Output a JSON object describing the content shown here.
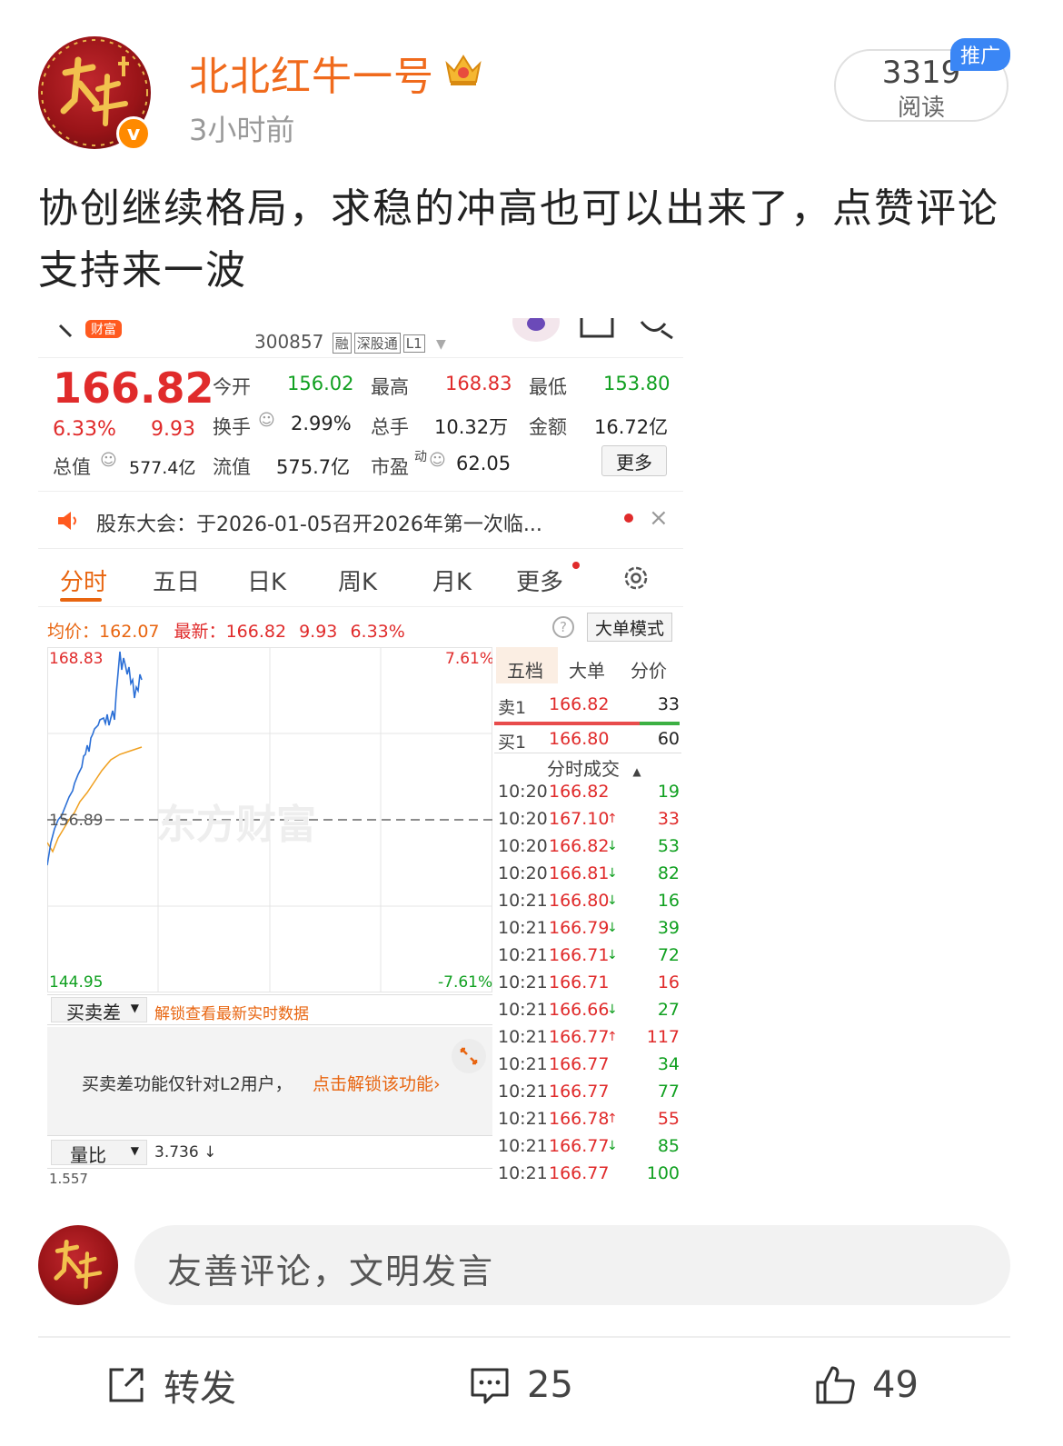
{
  "post": {
    "username": "北北红牛一号",
    "time": "3小时前",
    "read_count": "3319",
    "read_label": "阅读",
    "promo_badge": "推广",
    "verify_mark": "v",
    "text": "协创继续格局，求稳的冲高也可以出来了，点赞评论支持来一波"
  },
  "shot": {
    "app_badge": "财富",
    "stock_code": "300857",
    "tags": [
      "融",
      "深股通",
      "L1"
    ],
    "price": "166.82",
    "change_pct": "6.33%",
    "change_abs": "9.93",
    "quotes": {
      "open_label": "今开",
      "open": "156.02",
      "high_label": "最高",
      "high": "168.83",
      "low_label": "最低",
      "low": "153.80",
      "turnover_label": "换手",
      "turnover": "2.99%",
      "volume_label": "总手",
      "volume": "10.32万",
      "amount_label": "金额",
      "amount": "16.72亿",
      "mktcap_label": "总值",
      "mktcap": "577.4亿",
      "float_label": "流值",
      "float": "575.7亿",
      "pe_label": "市盈",
      "pe_sup": "动",
      "pe": "62.05",
      "more": "更多"
    },
    "notice": "股东大会：于2026-01-05召开2026年第一次临...",
    "tabs": [
      "分时",
      "五日",
      "日K",
      "周K",
      "月K",
      "更多"
    ],
    "avg_label": "均价：",
    "avg_value": "162.07",
    "latest_label": "最新：",
    "latest_price": "166.82",
    "latest_abs": "9.93",
    "latest_pct": "6.33%",
    "mode_button": "大单模式",
    "chart_labels": {
      "top_price": "168.83",
      "top_pct": "7.61%",
      "mid_price": "156.89",
      "bottom_price": "144.95",
      "bottom_pct": "-7.61%",
      "watermark": "东方财富"
    },
    "book_tabs": [
      "五档",
      "大单",
      "分价"
    ],
    "ask": {
      "label": "卖1",
      "price": "166.82",
      "vol": "33"
    },
    "bid": {
      "label": "买1",
      "price": "166.80",
      "vol": "60"
    },
    "trades_title": "分时成交",
    "trades": [
      {
        "t": "10:20",
        "p": "166.82",
        "arrow": "",
        "v": "19",
        "vc": "green"
      },
      {
        "t": "10:20",
        "p": "167.10",
        "arrow": "↑",
        "v": "33",
        "vc": "red"
      },
      {
        "t": "10:20",
        "p": "166.82",
        "arrow": "↓",
        "v": "53",
        "vc": "green"
      },
      {
        "t": "10:20",
        "p": "166.81",
        "arrow": "↓",
        "v": "82",
        "vc": "green"
      },
      {
        "t": "10:21",
        "p": "166.80",
        "arrow": "↓",
        "v": "16",
        "vc": "green"
      },
      {
        "t": "10:21",
        "p": "166.79",
        "arrow": "↓",
        "v": "39",
        "vc": "green"
      },
      {
        "t": "10:21",
        "p": "166.71",
        "arrow": "↓",
        "v": "72",
        "vc": "green"
      },
      {
        "t": "10:21",
        "p": "166.71",
        "arrow": "",
        "v": "16",
        "vc": "red"
      },
      {
        "t": "10:21",
        "p": "166.66",
        "arrow": "↓",
        "v": "27",
        "vc": "green"
      },
      {
        "t": "10:21",
        "p": "166.77",
        "arrow": "↑",
        "v": "117",
        "vc": "red"
      },
      {
        "t": "10:21",
        "p": "166.77",
        "arrow": "",
        "v": "34",
        "vc": "green"
      },
      {
        "t": "10:21",
        "p": "166.77",
        "arrow": "",
        "v": "77",
        "vc": "green"
      },
      {
        "t": "10:21",
        "p": "166.78",
        "arrow": "↑",
        "v": "55",
        "vc": "red"
      },
      {
        "t": "10:21",
        "p": "166.77",
        "arrow": "↓",
        "v": "85",
        "vc": "green"
      },
      {
        "t": "10:21",
        "p": "166.77",
        "arrow": "",
        "v": "100",
        "vc": "green"
      }
    ],
    "spread_dropdown": "买卖差",
    "spread_unlock": "解锁查看最新实时数据",
    "spread_msg": "买卖差功能仅针对L2用户，",
    "spread_link": "点击解锁该功能›",
    "ratio_dropdown": "量比",
    "ratio_value": "3.736 ↓",
    "ratio_axis": "1.557"
  },
  "comment_placeholder": "友善评论，文明发言",
  "actions": {
    "repost_label": "转发",
    "comment_count": "25",
    "like_count": "49"
  },
  "colors": {
    "username": "#f06a1c",
    "up": "#e02b2b",
    "down": "#10a020",
    "accent": "#e86510",
    "promo": "#3a86f5"
  }
}
